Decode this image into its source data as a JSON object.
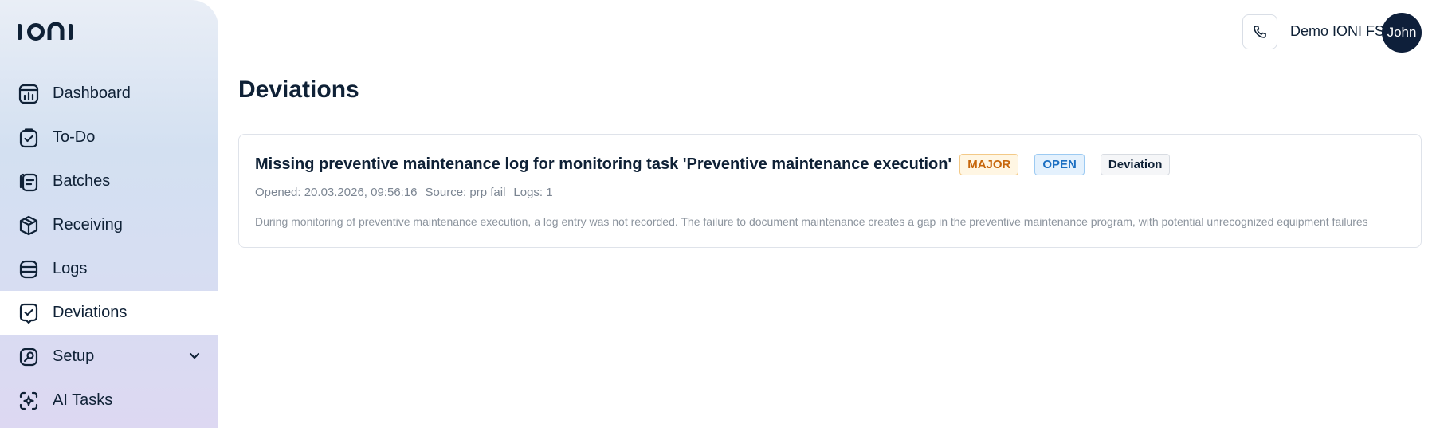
{
  "app": {
    "logo_text": "IONI"
  },
  "sidebar": {
    "items": [
      {
        "label": "Dashboard",
        "icon": "dashboard-icon"
      },
      {
        "label": "To-Do",
        "icon": "todo-icon"
      },
      {
        "label": "Batches",
        "icon": "batches-icon"
      },
      {
        "label": "Receiving",
        "icon": "receiving-icon"
      },
      {
        "label": "Logs",
        "icon": "logs-icon"
      },
      {
        "label": "Deviations",
        "icon": "deviations-icon",
        "active": true
      },
      {
        "label": "Setup",
        "icon": "setup-icon",
        "expandable": true
      },
      {
        "label": "AI Tasks",
        "icon": "ai-tasks-icon"
      }
    ]
  },
  "header": {
    "org_name": "Demo IONI FS",
    "avatar_text": "John",
    "phone_icon": "phone-icon"
  },
  "main": {
    "title": "Deviations",
    "deviations": [
      {
        "title": "Missing preventive maintenance log for monitoring task 'Preventive maintenance execution'",
        "severity": "MAJOR",
        "status": "OPEN",
        "type": "Deviation",
        "opened": "Opened: 20.03.2026, 09:56:16",
        "source": "Source: prp fail",
        "logs": "Logs: 1",
        "description": "During monitoring of preventive maintenance execution, a log entry was not recorded. The failure to document maintenance creates a gap in the preventive maintenance program, with potential unrecognized equipment failures"
      }
    ]
  },
  "colors": {
    "primary": "#0f2136",
    "major": "#c7670d",
    "open": "#1b6fc2",
    "active_bg": "#ffffff"
  }
}
